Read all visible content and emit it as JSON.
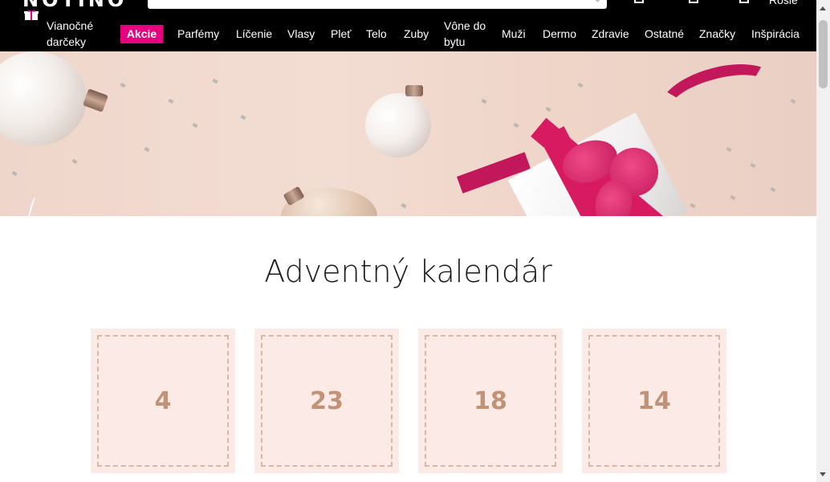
{
  "header": {
    "logo": "NOTINO",
    "login_label": "Rosie"
  },
  "nav": {
    "promo_label": "Vianočné darčeky",
    "sale_label": "Akcie",
    "items": [
      {
        "label": "Parfémy"
      },
      {
        "label": "Líčenie"
      },
      {
        "label": "Vlasy"
      },
      {
        "label": "Pleť"
      },
      {
        "label": "Telo"
      },
      {
        "label": "Zuby"
      },
      {
        "label": "Vône do bytu"
      },
      {
        "label": "Muži"
      },
      {
        "label": "Dermo"
      },
      {
        "label": "Zdravie"
      },
      {
        "label": "Ostatné"
      },
      {
        "label": "Značky"
      },
      {
        "label": "Inšpirácia"
      }
    ],
    "sale_color": "#e6007e"
  },
  "main": {
    "title": "Adventný kalendár",
    "days": [
      {
        "number": "4"
      },
      {
        "number": "23"
      },
      {
        "number": "18"
      },
      {
        "number": "14"
      }
    ]
  },
  "colors": {
    "header_bg": "#000000",
    "banner_bg": "#efd6cb",
    "day_bg": "#fbeae6",
    "day_text": "#c09278"
  }
}
